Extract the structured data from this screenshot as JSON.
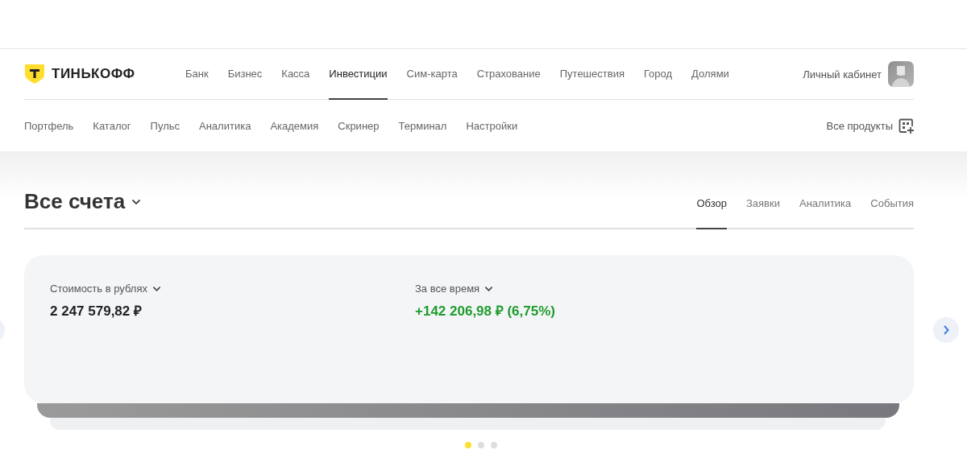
{
  "logo": {
    "text": "ТИНЬКОФФ"
  },
  "main_nav": [
    {
      "label": "Банк",
      "selected": false
    },
    {
      "label": "Бизнес",
      "selected": false
    },
    {
      "label": "Касса",
      "selected": false
    },
    {
      "label": "Инвестиции",
      "selected": true
    },
    {
      "label": "Сим-карта",
      "selected": false
    },
    {
      "label": "Страхование",
      "selected": false
    },
    {
      "label": "Путешествия",
      "selected": false
    },
    {
      "label": "Город",
      "selected": false
    },
    {
      "label": "Долями",
      "selected": false
    }
  ],
  "account_link": "Личный кабинет",
  "sub_nav": [
    "Портфель",
    "Каталог",
    "Пульс",
    "Аналитика",
    "Академия",
    "Скринер",
    "Терминал",
    "Настройки"
  ],
  "all_products": "Все продукты",
  "page_title": "Все счета",
  "tabs": [
    {
      "label": "Обзор",
      "selected": true
    },
    {
      "label": "Заявки",
      "selected": false
    },
    {
      "label": "Аналитика",
      "selected": false
    },
    {
      "label": "События",
      "selected": false
    }
  ],
  "metrics": [
    {
      "label": "Стоимость в рублях",
      "value": "2 247 579,82 ₽",
      "kind": "neutral"
    },
    {
      "label": "За все время",
      "value": "+142 206,98 ₽ (6,75%)",
      "kind": "gain"
    }
  ],
  "carousel_dots": [
    {
      "selected": true
    },
    {
      "selected": false
    },
    {
      "selected": false
    }
  ]
}
